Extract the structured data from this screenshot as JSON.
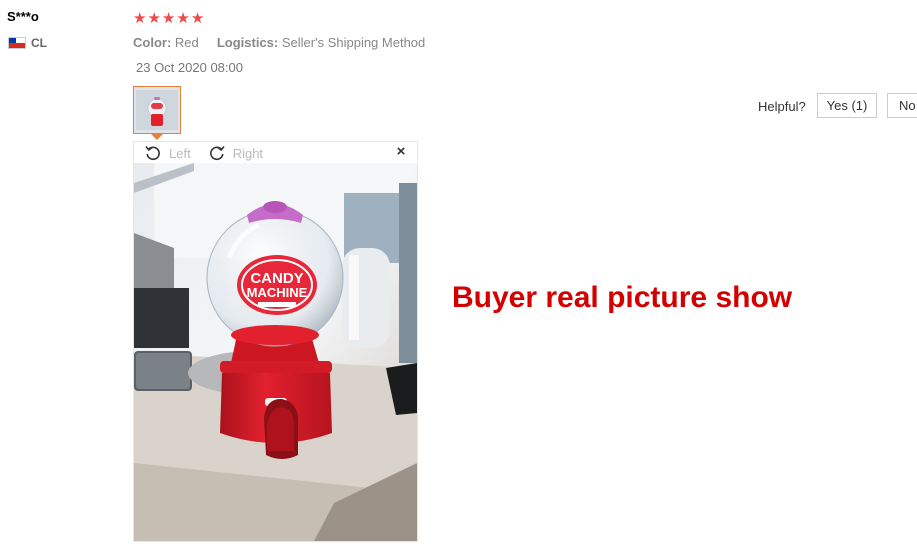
{
  "reviewer": {
    "name": "S***o",
    "country": "CL"
  },
  "rating": {
    "stars": 5,
    "max": 5
  },
  "attributes": {
    "color_label": "Color:",
    "color_value": "Red",
    "logistics_label": "Logistics:",
    "logistics_value": "Seller's Shipping Method"
  },
  "date": "23 Oct 2020 08:00",
  "helpful": {
    "label": "Helpful?",
    "yes_label": "Yes (1)",
    "no_label": "No"
  },
  "viewer": {
    "rotate_left_label": "Left",
    "rotate_right_label": "Right",
    "close_symbol": "×"
  },
  "photo": {
    "product_label_line1": "CANDY",
    "product_label_line2": "MACHINE"
  },
  "caption": "Buyer real picture show",
  "colors": {
    "star": "#f0484b",
    "accent": "#e8803a",
    "caption": "#d40000"
  }
}
